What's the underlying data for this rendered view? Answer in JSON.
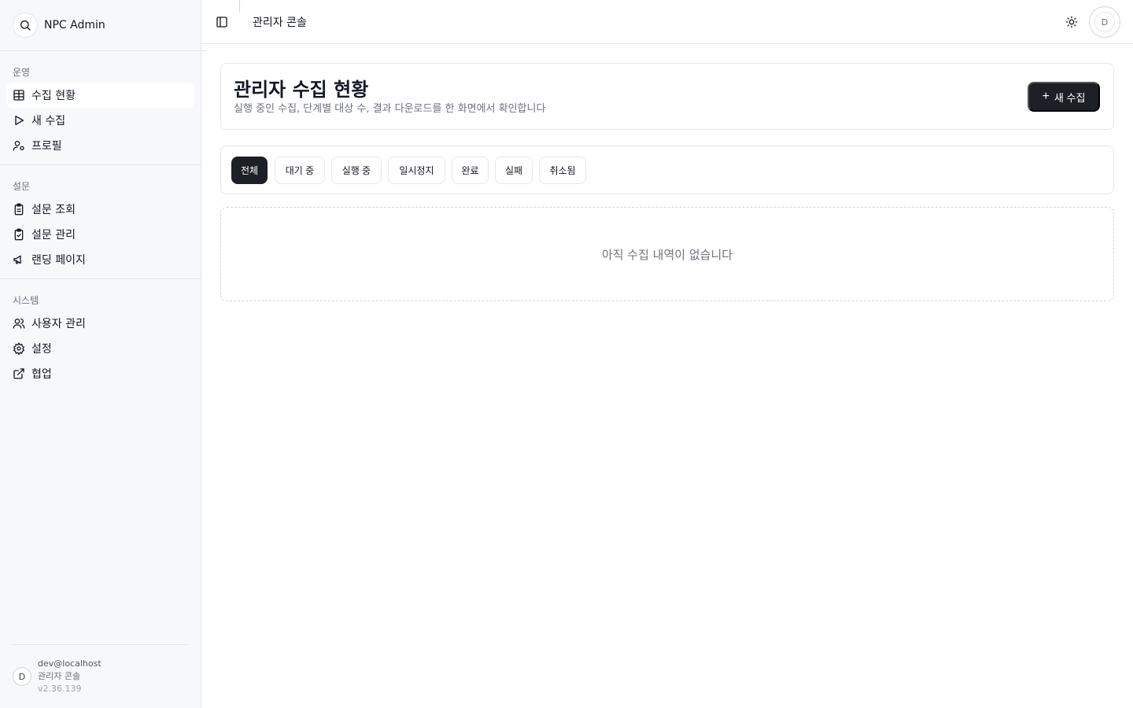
{
  "brand": {
    "name": "NPC Admin",
    "icon": "search-icon"
  },
  "sidebar": {
    "groups": [
      {
        "label": "운영",
        "items": [
          {
            "label": "수집 현황",
            "icon": "table-icon",
            "active": true
          },
          {
            "label": "새 수집",
            "icon": "play-icon"
          },
          {
            "label": "프로필",
            "icon": "user-cog-icon"
          }
        ]
      },
      {
        "label": "설문",
        "items": [
          {
            "label": "설문 조회",
            "icon": "clipboard-list-icon"
          },
          {
            "label": "설문 관리",
            "icon": "clipboard-check-icon"
          },
          {
            "label": "랜딩 페이지",
            "icon": "megaphone-icon"
          }
        ]
      },
      {
        "label": "시스템",
        "items": [
          {
            "label": "사용자 관리",
            "icon": "users-icon"
          },
          {
            "label": "설정",
            "icon": "gear-icon"
          },
          {
            "label": "협업",
            "icon": "external-link-icon"
          }
        ]
      }
    ],
    "user": {
      "avatar": "D",
      "email": "dev@localhost",
      "role": "관리자 콘솔",
      "version": "v2.36.139"
    }
  },
  "header": {
    "title": "관리자 콘솔",
    "avatar": "D"
  },
  "hero": {
    "title": "관리자 수집 현황",
    "subtitle": "실행 중인 수집, 단계별 대상 수, 결과 다운로드를 한 화면에서 확인합니다",
    "new_button": "새 수집"
  },
  "filters": [
    "전체",
    "대기 중",
    "실행 중",
    "일시정지",
    "완료",
    "실패",
    "취소됨"
  ],
  "empty_message": "아직 수집 내역이 없습니다",
  "colors": {
    "primary": "#1c1f26",
    "sidebar_bg": "#f7f8fa",
    "border": "#e5e7eb"
  }
}
